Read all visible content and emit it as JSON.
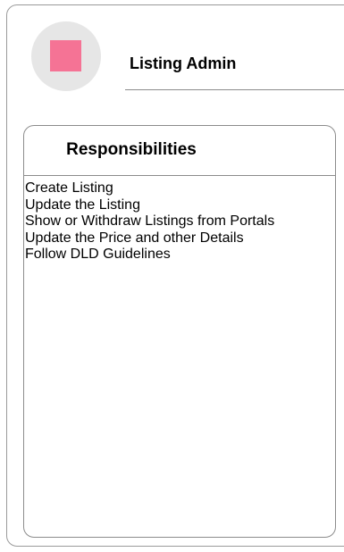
{
  "role": {
    "title": "Listing Admin",
    "avatar_color": "#f57395"
  },
  "responsibilities": {
    "heading": "Responsibilities",
    "items": [
      "Create Listing",
      "Update the Listing",
      "Show or Withdraw Listings from Portals",
      "Update the Price and other Details",
      "Follow DLD Guidelines"
    ]
  }
}
